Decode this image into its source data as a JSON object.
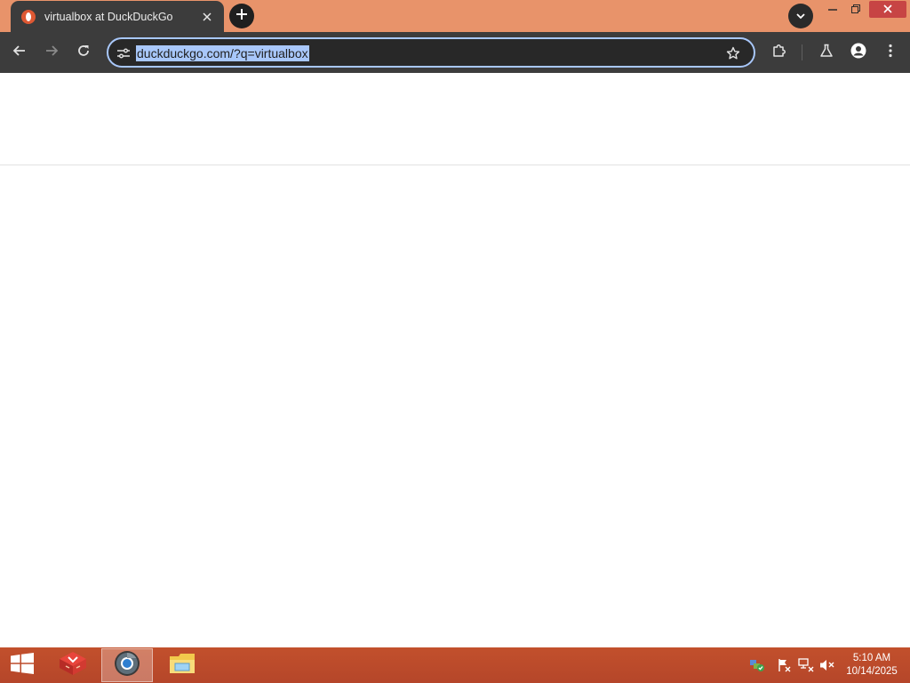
{
  "browser": {
    "tab": {
      "title": "virtualbox at DuckDuckGo",
      "favicon": "duckduckgo-icon",
      "close_icon": "close-icon"
    },
    "new_tab_icon": "plus-icon",
    "tab_search_icon": "chevron-down-icon",
    "window_controls": [
      "minimize-icon",
      "restore-icon",
      "close-icon"
    ],
    "toolbar": {
      "back_icon": "arrow-left-icon",
      "forward_icon": "arrow-right-icon",
      "reload_icon": "reload-icon",
      "site_info_icon": "tune-icon",
      "url": "duckduckgo.com/?q=virtualbox",
      "bookmark_icon": "star-icon",
      "extensions_icon": "puzzle-icon",
      "labs_icon": "flask-icon",
      "profile_icon": "person-icon",
      "menu_icon": "more-vert-icon"
    }
  },
  "taskbar": {
    "start_icon": "windows-icon",
    "apps": [
      {
        "name": "virtualbox-icon",
        "active": false
      },
      {
        "name": "chrome-icon",
        "active": true
      },
      {
        "name": "file-explorer-icon",
        "active": false
      }
    ],
    "tray_icons": [
      "security-shield-icon",
      "action-center-flag-icon",
      "network-icon",
      "volume-muted-icon"
    ],
    "clock": {
      "time": "5:10 AM",
      "date": "10/14/2025"
    }
  },
  "colors": {
    "titlebar": "#e8936a",
    "toolbar": "#3c3c3c",
    "omnibox_border": "#a8c7fa",
    "url_selection": "#a8c7fa",
    "taskbar": "#b94a2b",
    "close_button": "#c74444"
  }
}
